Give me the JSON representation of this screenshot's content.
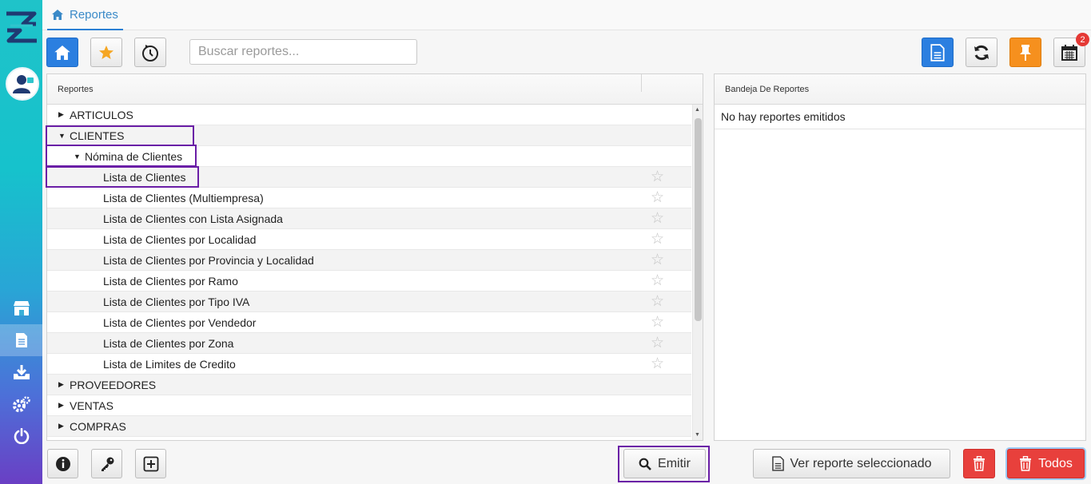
{
  "tab": {
    "label": "Reportes"
  },
  "search": {
    "placeholder": "Buscar reportes..."
  },
  "toolbar": {
    "notification_count": "2"
  },
  "left_panel": {
    "header": "Reportes",
    "tree": [
      {
        "label": "ARTICULOS",
        "level": 0,
        "expanded": false
      },
      {
        "label": "CLIENTES",
        "level": 0,
        "expanded": true
      },
      {
        "label": "Nómina de Clientes",
        "level": 1,
        "expanded": true
      },
      {
        "label": "Lista de Clientes",
        "level": 2
      },
      {
        "label": "Lista de Clientes (Multiempresa)",
        "level": 2
      },
      {
        "label": "Lista de Clientes con Lista Asignada",
        "level": 2
      },
      {
        "label": "Lista de Clientes por Localidad",
        "level": 2
      },
      {
        "label": "Lista de Clientes por Provincia y Localidad",
        "level": 2
      },
      {
        "label": "Lista de Clientes por Ramo",
        "level": 2
      },
      {
        "label": "Lista de Clientes por Tipo IVA",
        "level": 2
      },
      {
        "label": "Lista de Clientes por Vendedor",
        "level": 2
      },
      {
        "label": "Lista de Clientes por Zona",
        "level": 2
      },
      {
        "label": "Lista de Limites de Credito",
        "level": 2
      },
      {
        "label": "PROVEEDORES",
        "level": 0,
        "expanded": false
      },
      {
        "label": "VENTAS",
        "level": 0,
        "expanded": false
      },
      {
        "label": "COMPRAS",
        "level": 0,
        "expanded": false
      }
    ]
  },
  "right_panel": {
    "header": "Bandeja De Reportes",
    "empty_text": "No hay reportes emitidos"
  },
  "buttons": {
    "emitir": "Emitir",
    "ver_reporte": "Ver reporte seleccionado",
    "todos": "Todos"
  },
  "colors": {
    "accent": "#2b7fe0",
    "highlight": "#6a1ea6",
    "danger": "#e8403c",
    "pin": "#f6901e"
  }
}
